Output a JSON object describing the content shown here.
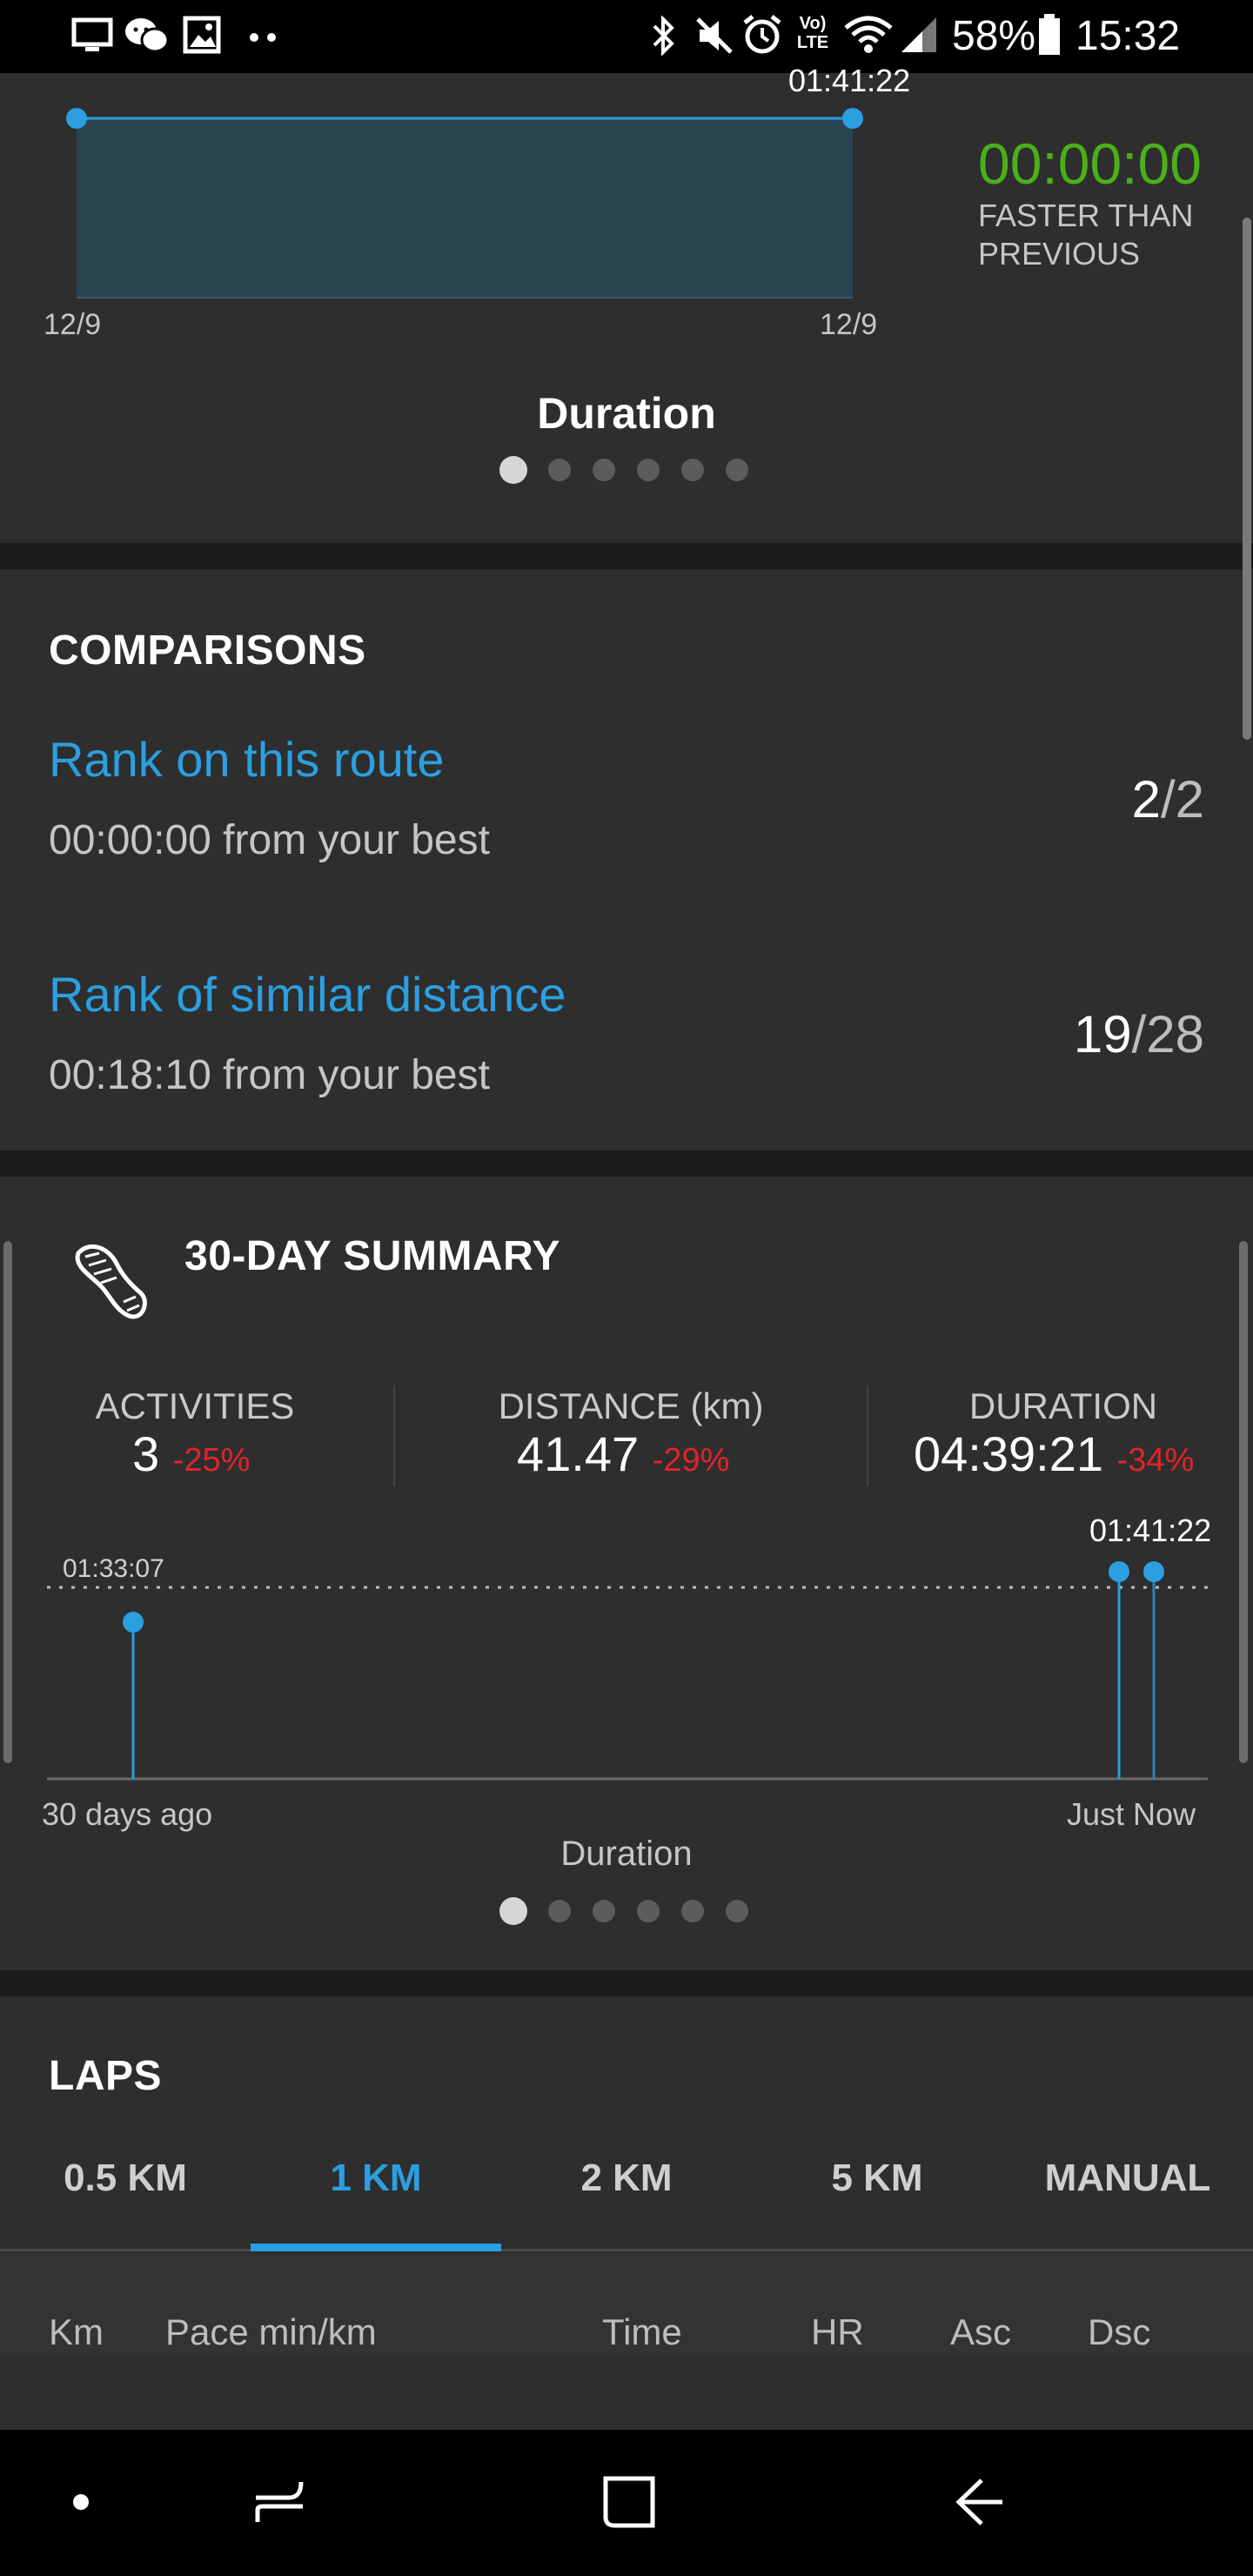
{
  "status_bar": {
    "battery_percent": "58%",
    "time": "15:32",
    "volte_top": "Vo)",
    "volte_bottom": "LTE",
    "icons": [
      "screen-icon",
      "wechat-icon",
      "image-icon",
      "more-dots-icon",
      "bluetooth-icon",
      "mute-icon",
      "alarm-icon",
      "volte-icon",
      "wifi-icon",
      "signal-icon",
      "battery-icon"
    ]
  },
  "duration_card": {
    "chart_data": {
      "type": "area",
      "title": "Duration",
      "x": [
        "12/9",
        "12/9"
      ],
      "values": [
        "01:41:22",
        "01:41:22"
      ],
      "peak_label": "01:41:22"
    },
    "comparison_value": "00:00:00",
    "comparison_label_line1": "FASTER THAN",
    "comparison_label_line2": "PREVIOUS",
    "colors": {
      "accent": "#2b9fe0",
      "area_fill": "#2b4452",
      "positive": "#4caf1a"
    }
  },
  "comparisons": {
    "title": "COMPARISONS",
    "items": [
      {
        "label": "Rank on this route",
        "detail": "00:00:00 from your best",
        "rank": "2",
        "total": "/2"
      },
      {
        "label": "Rank of similar distance",
        "detail": "00:18:10 from your best",
        "rank": "19",
        "total": "/28"
      }
    ]
  },
  "summary": {
    "title": "30-DAY SUMMARY",
    "icon": "shoe-icon",
    "stats": [
      {
        "label": "ACTIVITIES",
        "value": "3",
        "change": "-25%"
      },
      {
        "label": "DISTANCE (km)",
        "value": "41.47",
        "change": "-29%"
      },
      {
        "label": "DURATION",
        "value": "04:39:21",
        "change": "-34%"
      }
    ],
    "chart_data": {
      "type": "bar",
      "title": "Duration",
      "xlabel_start": "30 days ago",
      "xlabel_end": "Just Now",
      "reference_label": "01:33:07",
      "peak_label": "01:41:22",
      "points_minutes_ago_fraction": [
        0.075,
        0.935,
        0.965
      ],
      "values": [
        "01:23:00",
        "01:41:22",
        "01:41:22"
      ]
    }
  },
  "laps": {
    "title": "LAPS",
    "tabs": [
      "0.5 KM",
      "1 KM",
      "2 KM",
      "5 KM",
      "MANUAL"
    ],
    "active_tab": "1 KM",
    "columns": [
      "Km",
      "Pace min/km",
      "Time",
      "HR",
      "Asc",
      "Dsc"
    ]
  },
  "nav_bar": {
    "buttons": [
      "home-dot-icon",
      "recent-apps-icon",
      "home-square-icon",
      "back-arrow-icon"
    ]
  }
}
